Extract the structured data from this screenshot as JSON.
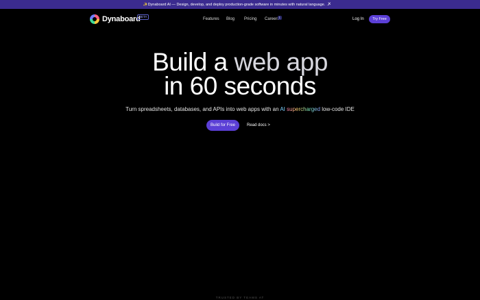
{
  "banner": {
    "message": "✨Dynaboard AI — Design, develop, and deploy production-grade software in minutes with natural language. →",
    "close": "×"
  },
  "nav": {
    "brand": "Dynaboard",
    "beta": "BETA",
    "links": [
      "Features",
      "Blog",
      "Pricing",
      "Careers"
    ],
    "careers_count": "1",
    "login": "Log In",
    "try_free": "Try Free"
  },
  "hero": {
    "line1_a": "Build a",
    "line1_b": "web app",
    "line2": "in 60 seconds",
    "sub_pre": "Turn spreadsheets, databases, and APIs into web apps with an ",
    "sub_ai": "AI",
    "sub_super": "supercharged",
    "sub_post": " low-code IDE",
    "cta_primary": "Build for Free",
    "cta_secondary": "Read docs >"
  },
  "footer_snip": "TRUSTED BY TEAMS AT"
}
